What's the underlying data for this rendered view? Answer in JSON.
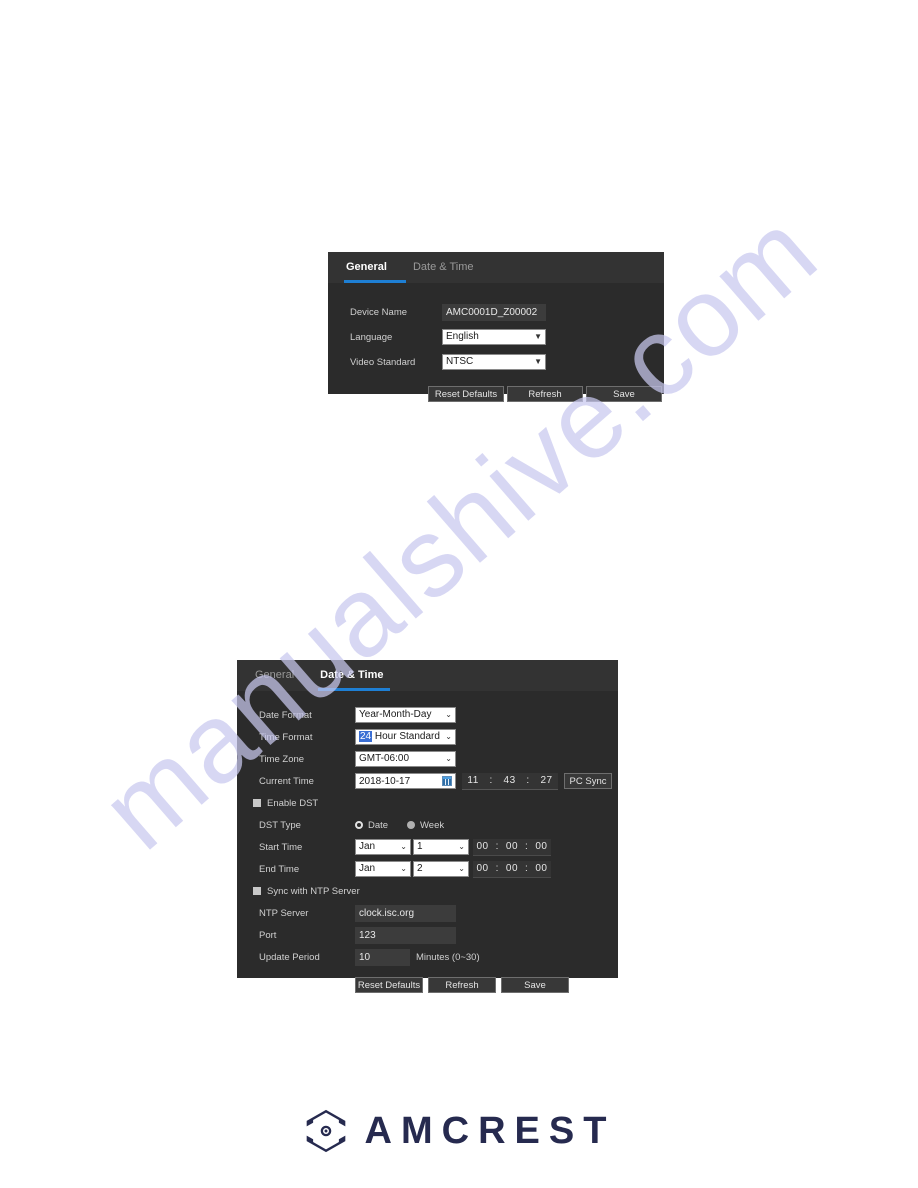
{
  "watermark": {
    "text": "manualshive.com",
    "color": "#c9c9ef"
  },
  "accent_color": "#1e7fd4",
  "panel_general": {
    "tabs": [
      {
        "label": "General",
        "active": true
      },
      {
        "label": "Date & Time",
        "active": false
      }
    ],
    "fields": {
      "device_name_label": "Device Name",
      "device_name_value": "AMC0001D_Z00002",
      "language_label": "Language",
      "language_value": "English",
      "video_standard_label": "Video Standard",
      "video_standard_value": "NTSC"
    },
    "buttons": {
      "reset": "Reset Defaults",
      "refresh": "Refresh",
      "save": "Save"
    }
  },
  "panel_datetime": {
    "tabs": [
      {
        "label": "General",
        "active": false
      },
      {
        "label": "Date & Time",
        "active": true
      }
    ],
    "fields": {
      "date_format_label": "Date Format",
      "date_format_value": "Year-Month-Day",
      "time_format_label": "Time Format",
      "time_format_value_selected": "24",
      "time_format_value_rest": " Hour  Standard",
      "time_zone_label": "Time Zone",
      "time_zone_value": "GMT-06:00",
      "current_time_label": "Current Time",
      "current_time_date": "2018-10-17",
      "current_time_hh": "11",
      "current_time_mm": "43",
      "current_time_ss": "27",
      "pc_sync_label": "PC Sync",
      "enable_dst_label": "Enable DST",
      "dst_type_label": "DST Type",
      "dst_type_date": "Date",
      "dst_type_week": "Week",
      "start_time_label": "Start Time",
      "start_month": "Jan",
      "start_day": "1",
      "start_hh": "00",
      "start_mm": "00",
      "start_ss": "00",
      "end_time_label": "End Time",
      "end_month": "Jan",
      "end_day": "2",
      "end_hh": "00",
      "end_mm": "00",
      "end_ss": "00",
      "sync_ntp_label": "Sync with NTP Server",
      "ntp_server_label": "NTP Server",
      "ntp_server_value": "clock.isc.org",
      "port_label": "Port",
      "port_value": "123",
      "update_period_label": "Update Period",
      "update_period_value": "10",
      "update_period_unit": "Minutes (0~30)"
    },
    "buttons": {
      "reset": "Reset Defaults",
      "refresh": "Refresh",
      "save": "Save"
    }
  },
  "footer": {
    "brand": "AMCREST",
    "logo_color": "#262a4f"
  }
}
